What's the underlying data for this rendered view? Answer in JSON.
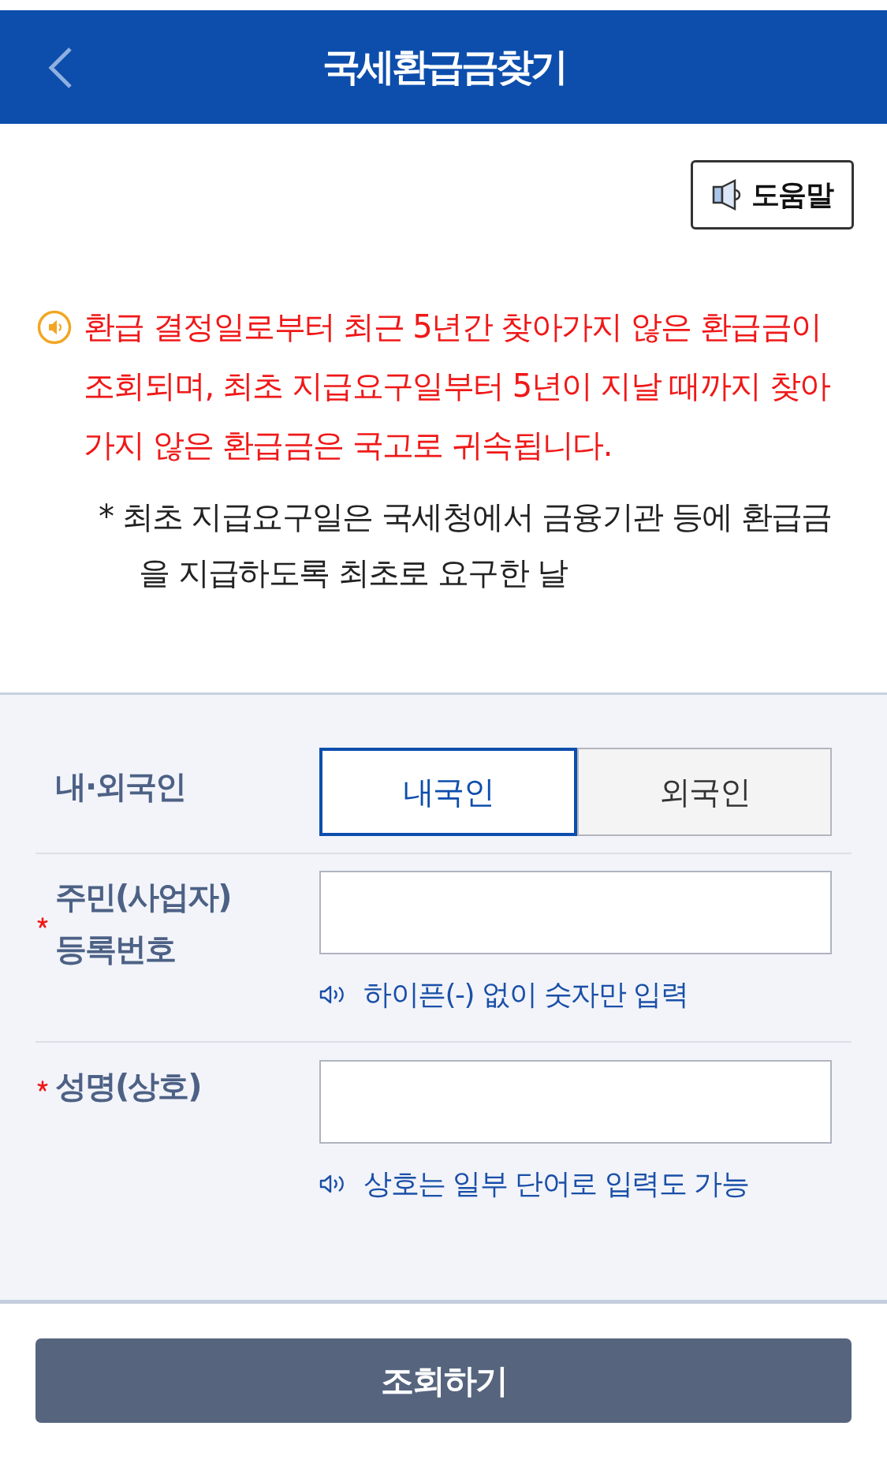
{
  "header": {
    "title": "국세환급금찾기"
  },
  "help_button": {
    "label": "도움말"
  },
  "notice": {
    "text": "환급 결정일로부터 최근 5년간 찾아가지 않은 환급금이 조회되며, 최초 지급요구일부터 5년이 지날 때까지 찾아가지 않은 환급금은 국고로 귀속됩니다.",
    "note": "* 최초 지급요구일은 국세청에서 금융기관 등에 환급금을 지급하도록 최초로 요구한 날"
  },
  "form": {
    "rows": [
      {
        "kind": "segmented",
        "label": "내·외국인",
        "required": false,
        "options": [
          {
            "label": "내국인",
            "selected": true
          },
          {
            "label": "외국인",
            "selected": false
          }
        ]
      },
      {
        "kind": "input",
        "label": "주민(사업자) 등록번호",
        "required": true,
        "hint": "하이픈(-) 없이 숫자만 입력"
      },
      {
        "kind": "input",
        "label": "성명(상호)",
        "required": true,
        "hint": "상호는 일부 단어로 입력도 가능"
      }
    ]
  },
  "submit_button": {
    "label": "조회하기"
  }
}
